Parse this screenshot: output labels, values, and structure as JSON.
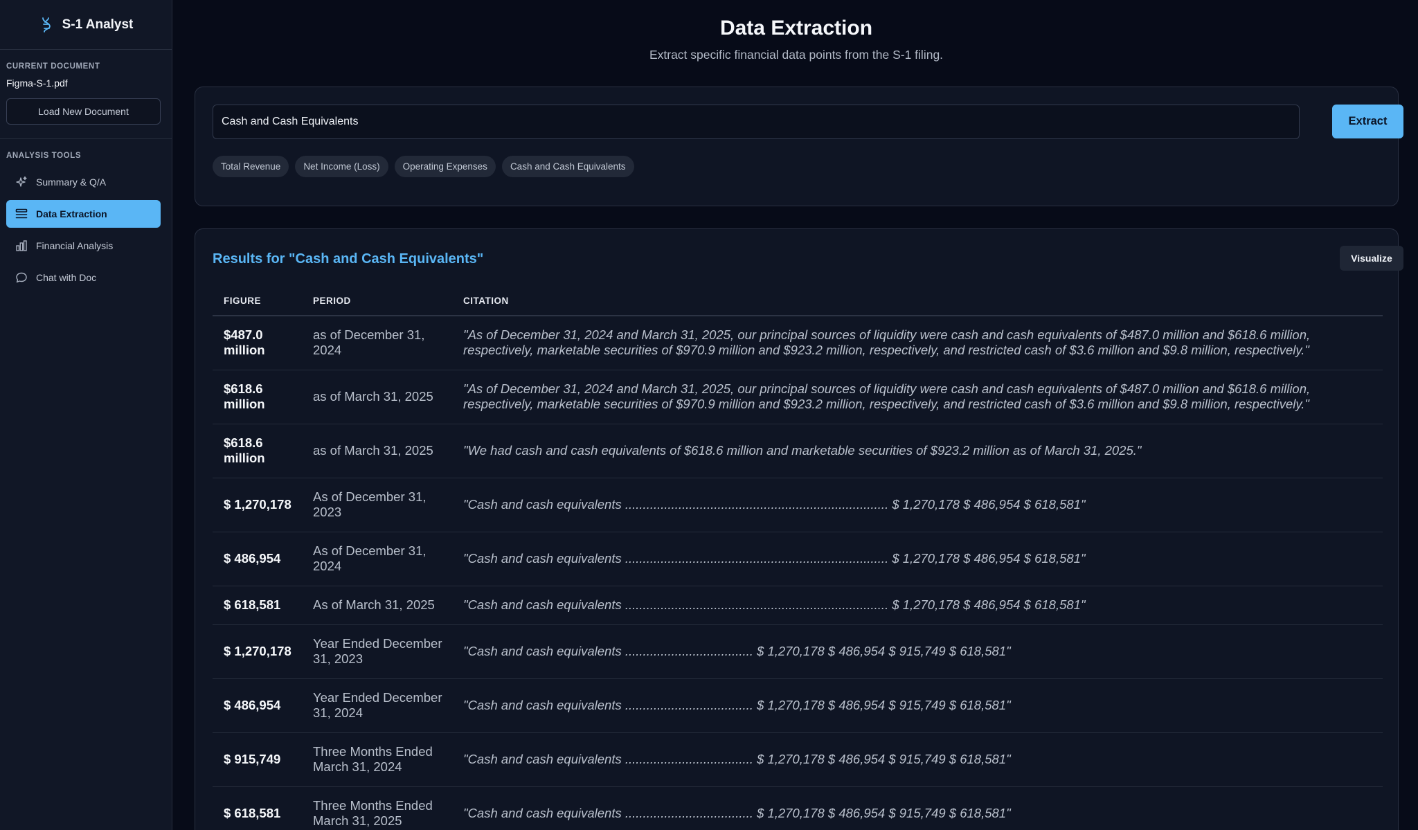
{
  "app": {
    "title": "S-1 Analyst"
  },
  "sidebar": {
    "current_document_label": "CURRENT DOCUMENT",
    "document_name": "Figma-S-1.pdf",
    "load_button": "Load New Document",
    "tools_label": "ANALYSIS TOOLS",
    "items": [
      {
        "label": "Summary & Q/A",
        "icon": "sparkles-icon",
        "active": false
      },
      {
        "label": "Data Extraction",
        "icon": "list-icon",
        "active": true
      },
      {
        "label": "Financial Analysis",
        "icon": "bar-chart-icon",
        "active": false
      },
      {
        "label": "Chat with Doc",
        "icon": "chat-bubble-icon",
        "active": false
      }
    ]
  },
  "header": {
    "title": "Data Extraction",
    "subtitle": "Extract specific financial data points from the S-1 filing."
  },
  "query": {
    "value": "Cash and Cash Equivalents",
    "extract_button": "Extract",
    "chips": [
      "Total Revenue",
      "Net Income (Loss)",
      "Operating Expenses",
      "Cash and Cash Equivalents"
    ]
  },
  "results": {
    "title": "Results for \"Cash and Cash Equivalents\"",
    "visualize_button": "Visualize",
    "columns": [
      "FIGURE",
      "PERIOD",
      "CITATION"
    ],
    "rows": [
      {
        "figure": "$487.0 million",
        "period": "as of December 31, 2024",
        "citation": "\"As of December 31, 2024 and March 31, 2025, our principal sources of liquidity were cash and cash equivalents of $487.0 million and $618.6 million, respectively, marketable securities of $970.9 million and $923.2 million, respectively, and restricted cash of $3.6 million and $9.8 million, respectively.\""
      },
      {
        "figure": "$618.6 million",
        "period": "as of March 31, 2025",
        "citation": "\"As of December 31, 2024 and March 31, 2025, our principal sources of liquidity were cash and cash equivalents of $487.0 million and $618.6 million, respectively, marketable securities of $970.9 million and $923.2 million, respectively, and restricted cash of $3.6 million and $9.8 million, respectively.\""
      },
      {
        "figure": "$618.6 million",
        "period": "as of March 31, 2025",
        "citation": "\"We had cash and cash equivalents of $618.6 million and marketable securities of $923.2 million as of March 31, 2025.\""
      },
      {
        "figure": "$ 1,270,178",
        "period": "As of December 31, 2023",
        "citation": "\"Cash and cash equivalents .......................................................................... $ 1,270,178 $ 486,954 $ 618,581\""
      },
      {
        "figure": "$ 486,954",
        "period": "As of December 31, 2024",
        "citation": "\"Cash and cash equivalents .......................................................................... $ 1,270,178 $ 486,954 $ 618,581\""
      },
      {
        "figure": "$ 618,581",
        "period": "As of March 31, 2025",
        "citation": "\"Cash and cash equivalents .......................................................................... $ 1,270,178 $ 486,954 $ 618,581\""
      },
      {
        "figure": "$ 1,270,178",
        "period": "Year Ended December 31, 2023",
        "citation": "\"Cash and cash equivalents .................................... $ 1,270,178 $ 486,954 $ 915,749 $ 618,581\""
      },
      {
        "figure": "$ 486,954",
        "period": "Year Ended December 31, 2024",
        "citation": "\"Cash and cash equivalents .................................... $ 1,270,178 $ 486,954 $ 915,749 $ 618,581\""
      },
      {
        "figure": "$ 915,749",
        "period": "Three Months Ended March 31, 2024",
        "citation": "\"Cash and cash equivalents .................................... $ 1,270,178 $ 486,954 $ 915,749 $ 618,581\""
      },
      {
        "figure": "$ 618,581",
        "period": "Three Months Ended March 31, 2025",
        "citation": "\"Cash and cash equivalents .................................... $ 1,270,178 $ 486,954 $ 915,749 $ 618,581\""
      }
    ]
  },
  "colors": {
    "accent": "#5ab6f5",
    "background": "#070b18",
    "sidebar": "#111726",
    "card": "#0f1524"
  }
}
